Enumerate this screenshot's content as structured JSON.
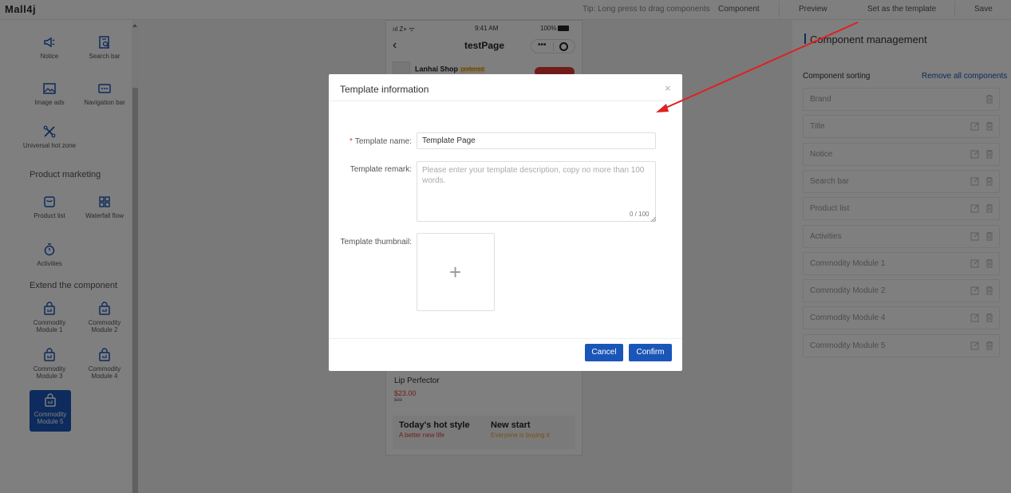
{
  "app": {
    "logo": "Mall4j"
  },
  "topbar": {
    "tip": "Tip: Long press to drag components",
    "component": "Component",
    "preview": "Preview",
    "set_template": "Set as the template",
    "save": "Save"
  },
  "sidebar": {
    "basic": [
      {
        "label": "Notice",
        "icon": "megaphone-icon"
      },
      {
        "label": "Search bar",
        "icon": "search-doc-icon"
      },
      {
        "label": "Image ads",
        "icon": "image-icon"
      },
      {
        "label": "Navigation bar",
        "icon": "nav-bar-icon"
      },
      {
        "label": "Universal hot zone",
        "icon": "hot-zone-icon"
      }
    ],
    "marketing_title": "Product marketing",
    "marketing": [
      {
        "label": "Product list",
        "icon": "bag-icon"
      },
      {
        "label": "Waterfall flow",
        "icon": "grid-icon"
      },
      {
        "label": "Activities",
        "icon": "stopwatch-icon"
      }
    ],
    "extend_title": "Extend the component",
    "extend": [
      {
        "label": "Commodity Module 1",
        "icon": "basket-icon"
      },
      {
        "label": "Commodity Module 2",
        "icon": "basket-icon"
      },
      {
        "label": "Commodity Module 3",
        "icon": "basket-icon"
      },
      {
        "label": "Commodity Module 4",
        "icon": "basket-icon"
      },
      {
        "label": "Commodity Module 5",
        "icon": "basket-icon"
      }
    ]
  },
  "phone": {
    "status_left": "ııl Z+ ᯤ",
    "status_time": "9:41 AM",
    "status_battery": "100%",
    "title": "testPage",
    "shop_name": "Lanhai Shop",
    "shop_badge": "preferred",
    "product_name": "Lip Perfector",
    "product_price": "$23.00",
    "product_old_price": "$90",
    "promo_left_title": "Today's hot style",
    "promo_left_sub": "A better new life",
    "promo_right_title": "New start",
    "promo_right_sub": "Everyone is buying it"
  },
  "right_panel": {
    "title": "Component management",
    "sorting": "Component sorting",
    "remove_all": "Remove all components",
    "items": [
      "Brand",
      "Title",
      "Notice",
      "Search bar",
      "Product list",
      "Activities",
      "Commodity Module 1",
      "Commodity Module 2",
      "Commodity Module 4",
      "Commodity Module 5"
    ]
  },
  "modal": {
    "title": "Template information",
    "close": "×",
    "name_label": "Template name:",
    "name_value": "Template Page",
    "remark_label": "Template remark:",
    "remark_placeholder": "Please enter your template description, copy no more than 100 words.",
    "remark_count": "0 / 100",
    "thumb_label": "Template thumbnail:",
    "plus": "+",
    "cancel": "Cancel",
    "confirm": "Confirm"
  },
  "colors": {
    "accent": "#1a56b8",
    "danger": "#e53935",
    "arrow": "#e02020"
  }
}
